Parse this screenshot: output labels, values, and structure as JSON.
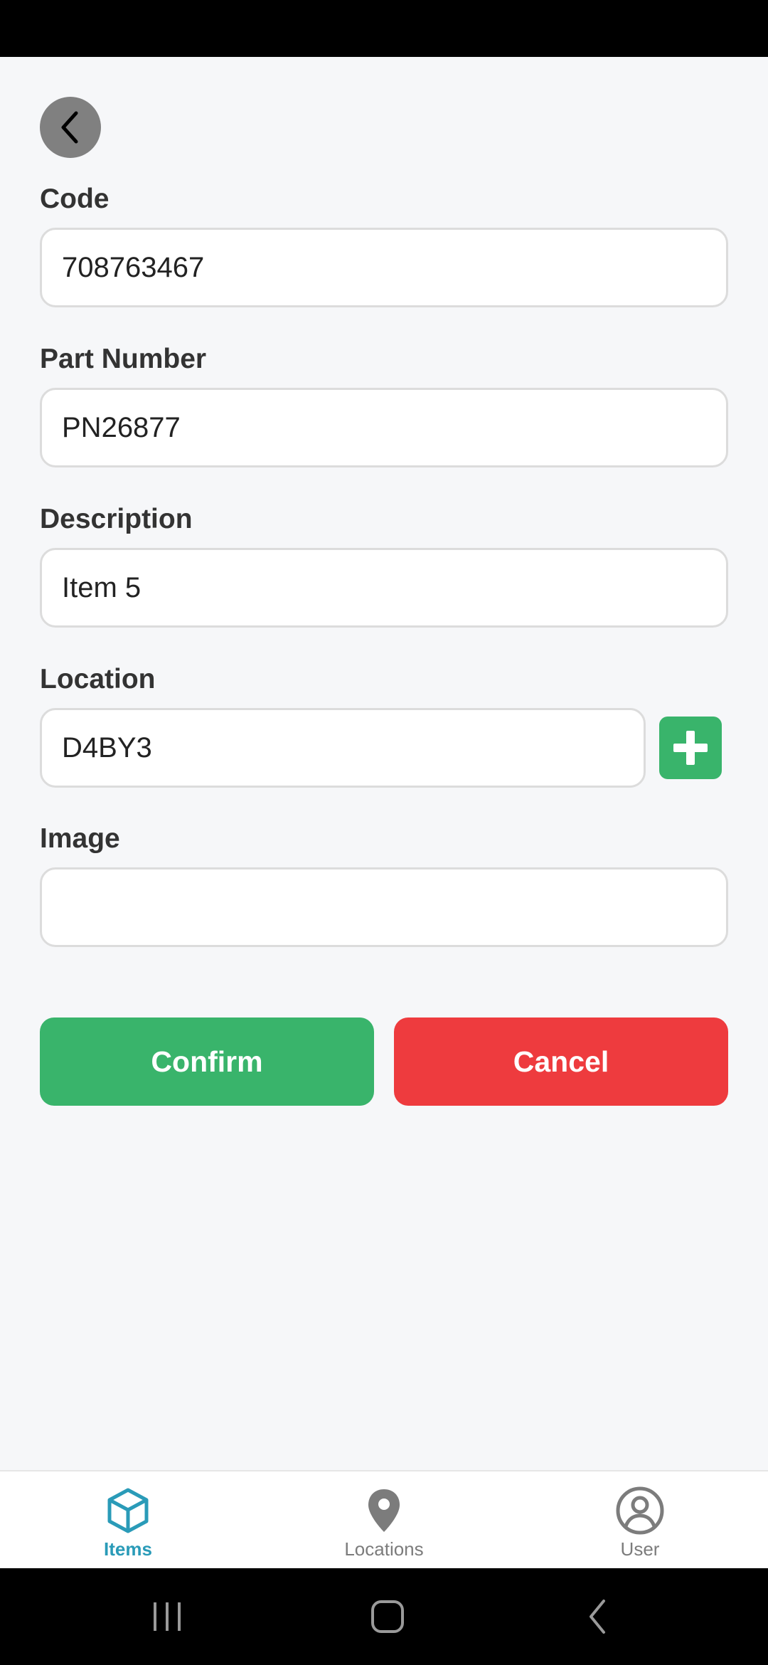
{
  "form": {
    "code": {
      "label": "Code",
      "value": "708763467"
    },
    "part_number": {
      "label": "Part Number",
      "value": "PN26877"
    },
    "description": {
      "label": "Description",
      "value": "Item 5"
    },
    "location": {
      "label": "Location",
      "value": "D4BY3"
    },
    "image": {
      "label": "Image",
      "value": ""
    }
  },
  "actions": {
    "confirm_label": "Confirm",
    "cancel_label": "Cancel"
  },
  "bottom_nav": {
    "items": [
      {
        "label": "Items",
        "icon": "cube-icon",
        "active": true
      },
      {
        "label": "Locations",
        "icon": "map-pin-icon",
        "active": false
      },
      {
        "label": "User",
        "icon": "user-circle-icon",
        "active": false
      }
    ]
  },
  "colors": {
    "confirm": "#39b46b",
    "cancel": "#ee3b3e",
    "active_tab": "#2a9bb8",
    "inactive_tab": "#7c7c7c"
  }
}
